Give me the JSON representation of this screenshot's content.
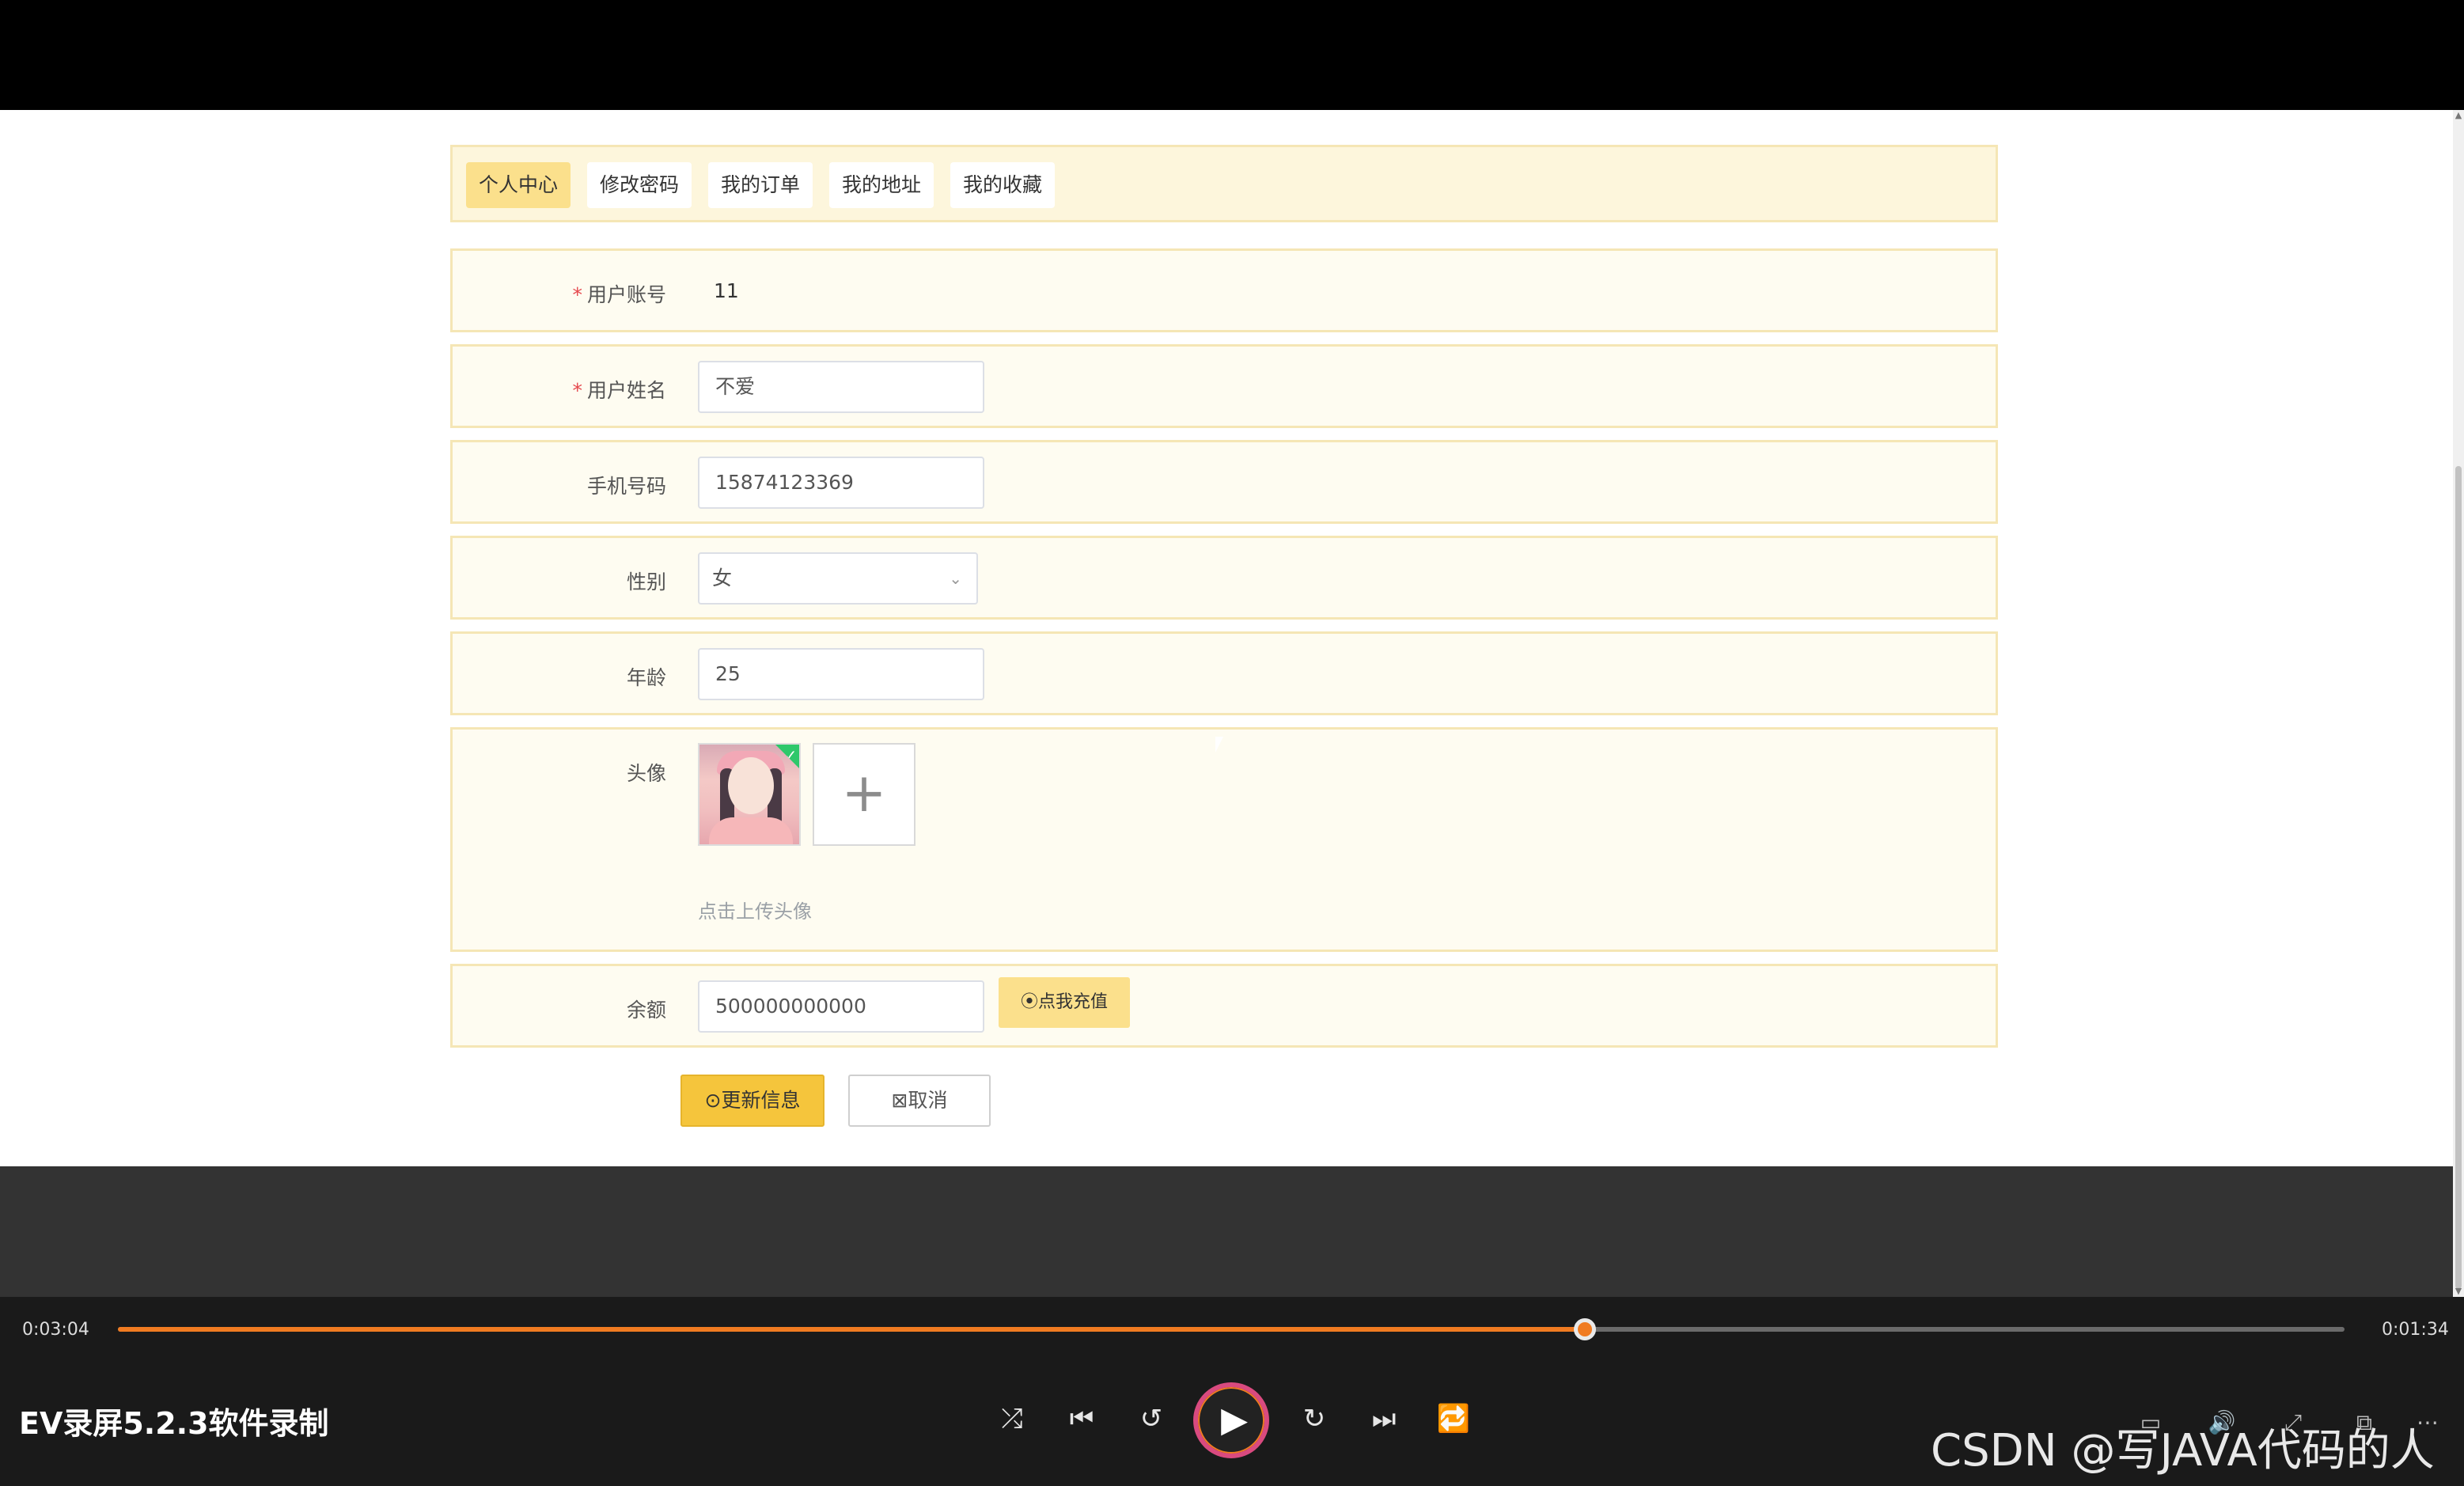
{
  "tabs": [
    "个人中心",
    "修改密码",
    "我的订单",
    "我的地址",
    "我的收藏"
  ],
  "form": {
    "account": {
      "label": "用户账号",
      "value": "11"
    },
    "name": {
      "label": "用户姓名",
      "value": "不爱"
    },
    "phone": {
      "label": "手机号码",
      "value": "15874123369"
    },
    "gender": {
      "label": "性别",
      "value": "女"
    },
    "age": {
      "label": "年龄",
      "value": "25"
    },
    "avatar": {
      "label": "头像",
      "hint": "点击上传头像"
    },
    "balance": {
      "label": "余额",
      "value": "500000000000",
      "recharge_label": "⦿点我充值"
    }
  },
  "actions": {
    "update_label": "⊙更新信息",
    "cancel_label": "⊠取消"
  },
  "player": {
    "current_time": "0:03:04",
    "duration": "0:01:34",
    "progress": 0.659,
    "title": "EV录屏5.2.3软件录制",
    "accent": "#f07b21"
  },
  "watermark": "CSDN @写JAVA代码的人"
}
